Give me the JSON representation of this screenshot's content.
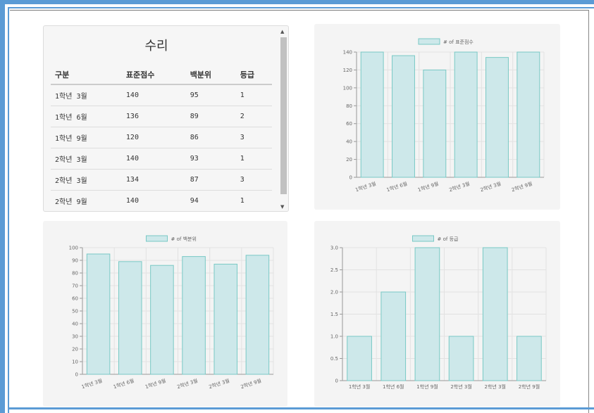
{
  "table": {
    "title": "수리",
    "headers": [
      "구분",
      "표준점수",
      "백분위",
      "등급"
    ],
    "rows": [
      [
        "1학년 3월",
        "140",
        "95",
        "1"
      ],
      [
        "1학년 6월",
        "136",
        "89",
        "2"
      ],
      [
        "1학년 9월",
        "120",
        "86",
        "3"
      ],
      [
        "2학년 3월",
        "140",
        "93",
        "1"
      ],
      [
        "2학년 3월",
        "134",
        "87",
        "3"
      ],
      [
        "2학년 9월",
        "140",
        "94",
        "1"
      ]
    ],
    "scroll_up_glyph": "▲",
    "scroll_down_glyph": "▼"
  },
  "chart_data": [
    {
      "type": "bar",
      "categories": [
        "1학년 3월",
        "1학년 6월",
        "1학년 9월",
        "2학년 3월",
        "2학년 3월",
        "2학년 9월"
      ],
      "series": [
        {
          "name": "# of 표준점수",
          "values": [
            140,
            136,
            120,
            140,
            134,
            140
          ]
        }
      ],
      "ylim": [
        0,
        140
      ],
      "yticks": [
        "0",
        "20",
        "40",
        "60",
        "80",
        "100",
        "120",
        "140"
      ],
      "tick_rotation": "rotated",
      "legend": "top-center",
      "grid": true,
      "bar_fill": "#cde8ea",
      "bar_stroke": "#79c9c5"
    },
    {
      "type": "bar",
      "categories": [
        "1학년 3월",
        "1학년 6월",
        "1학년 9월",
        "2학년 3월",
        "2학년 3월",
        "2학년 9월"
      ],
      "series": [
        {
          "name": "# of 백분위",
          "values": [
            95,
            89,
            86,
            93,
            87,
            94
          ]
        }
      ],
      "ylim": [
        0,
        100
      ],
      "yticks": [
        "0",
        "10",
        "20",
        "30",
        "40",
        "50",
        "60",
        "70",
        "80",
        "90",
        "100"
      ],
      "tick_rotation": "rotated",
      "legend": "top-center",
      "grid": true,
      "bar_fill": "#cde8ea",
      "bar_stroke": "#79c9c5"
    },
    {
      "type": "bar",
      "categories": [
        "1학년 3월",
        "1학년 6월",
        "1학년 9월",
        "2학년 3월",
        "2학년 3월",
        "2학년 9월"
      ],
      "series": [
        {
          "name": "# of 등급",
          "values": [
            1,
            2,
            3,
            1,
            3,
            1
          ]
        }
      ],
      "ylim": [
        0,
        3
      ],
      "yticks": [
        "0",
        "0.5",
        "1.0",
        "1.5",
        "2.0",
        "2.5",
        "3.0"
      ],
      "tick_rotation": "horizontal",
      "legend": "top-center",
      "grid": true,
      "bar_fill": "#cde8ea",
      "bar_stroke": "#79c9c5"
    }
  ],
  "colors": {
    "frame_accent": "#5b9bd5",
    "panel_bg": "#f4f4f4",
    "bar_fill": "#cde8ea",
    "bar_stroke": "#79c9c5"
  }
}
